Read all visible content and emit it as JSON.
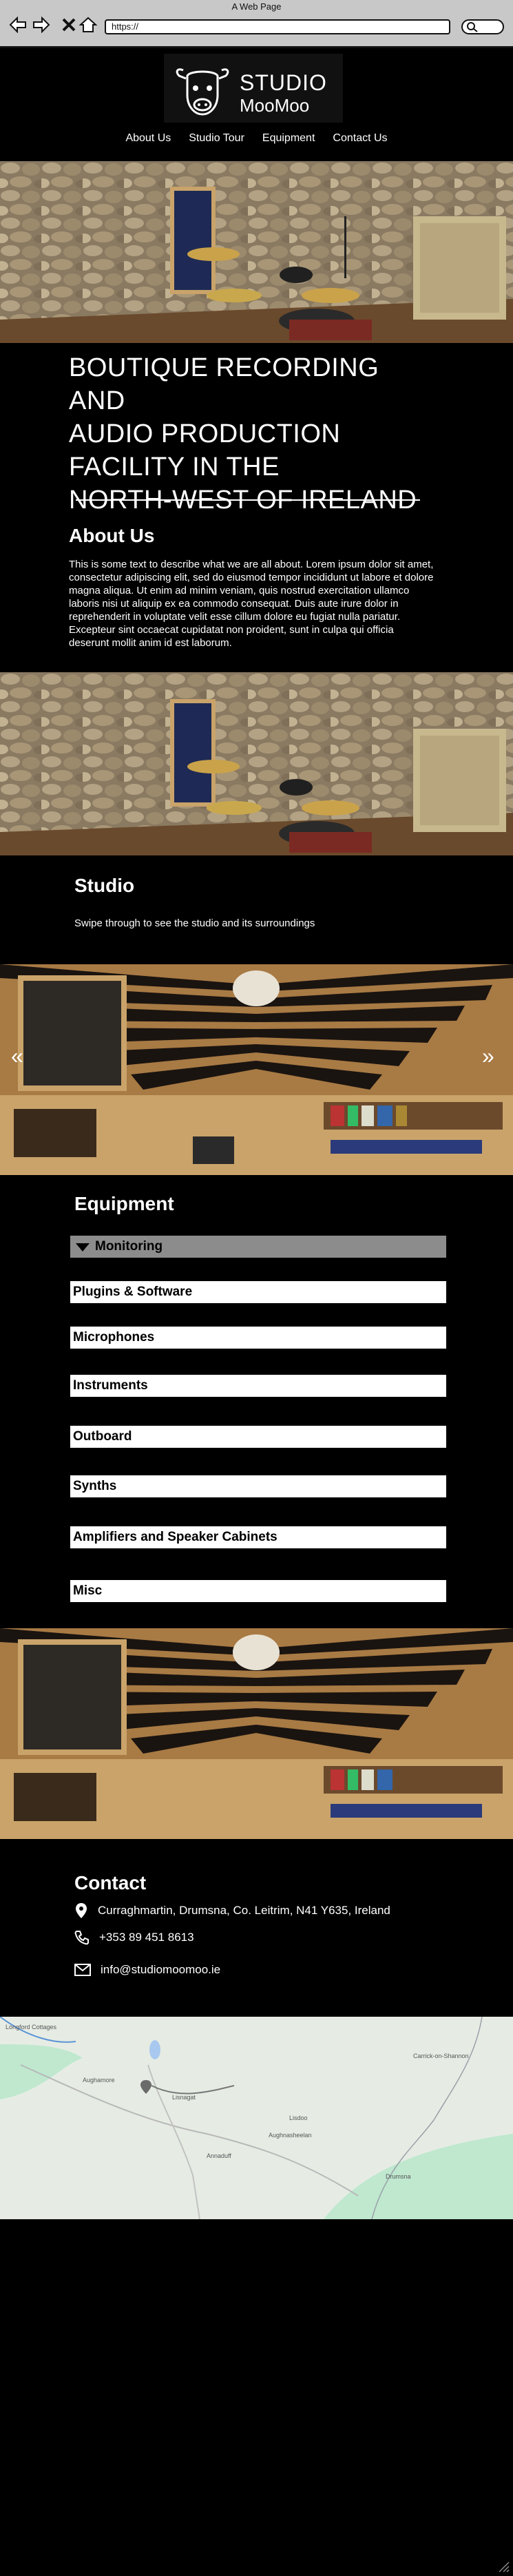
{
  "browser": {
    "window_title": "A Web Page",
    "url": "https://"
  },
  "header": {
    "brand_line1": "STUDIO",
    "brand_line2": "MooMoo",
    "nav": [
      "About Us",
      "Studio Tour",
      "Equipment",
      "Contact Us"
    ]
  },
  "hero": {
    "lines": [
      "BOUTIQUE RECORDING AND",
      "AUDIO PRODUCTION",
      "FACILITY IN THE",
      "NORTH-WEST OF IRELAND"
    ]
  },
  "about": {
    "heading": "About Us",
    "text": "This is some text to describe what we are all about. Lorem ipsum dolor sit amet, consectetur adipiscing elit, sed do eiusmod tempor incididunt ut labore et dolore magna aliqua. Ut enim ad minim veniam, quis nostrud exercitation ullamco laboris nisi ut aliquip ex ea commodo consequat. Duis aute irure dolor in reprehenderit in voluptate velit esse cillum dolore eu fugiat nulla pariatur. Excepteur sint occaecat cupidatat non proident, sunt in culpa qui officia deserunt mollit anim id est laborum."
  },
  "studio": {
    "heading": "Studio",
    "subtext": "Swipe through to see the studio and its surroundings",
    "prev": "«",
    "next": "»"
  },
  "equipment": {
    "heading": "Equipment",
    "items": [
      "Monitoring",
      "Plugins & Software",
      "Microphones",
      "Instruments",
      "Outboard",
      "Synths",
      "Amplifiers and Speaker Cabinets",
      "Misc"
    ]
  },
  "contact": {
    "heading": "Contact",
    "address": "Curraghmartin, Drumsna, Co. Leitrim, N41 Y635, Ireland",
    "phone": "+353 89 451 8613",
    "email": "info@studiomoomoo.ie"
  },
  "map": {
    "labels": [
      "Longford Cottages",
      "Aughamore",
      "Lisdoo",
      "Drumsna",
      "Carrick-on-Shannon",
      "Aughnasheelan",
      "Lisnagat",
      "Annaduff"
    ]
  }
}
